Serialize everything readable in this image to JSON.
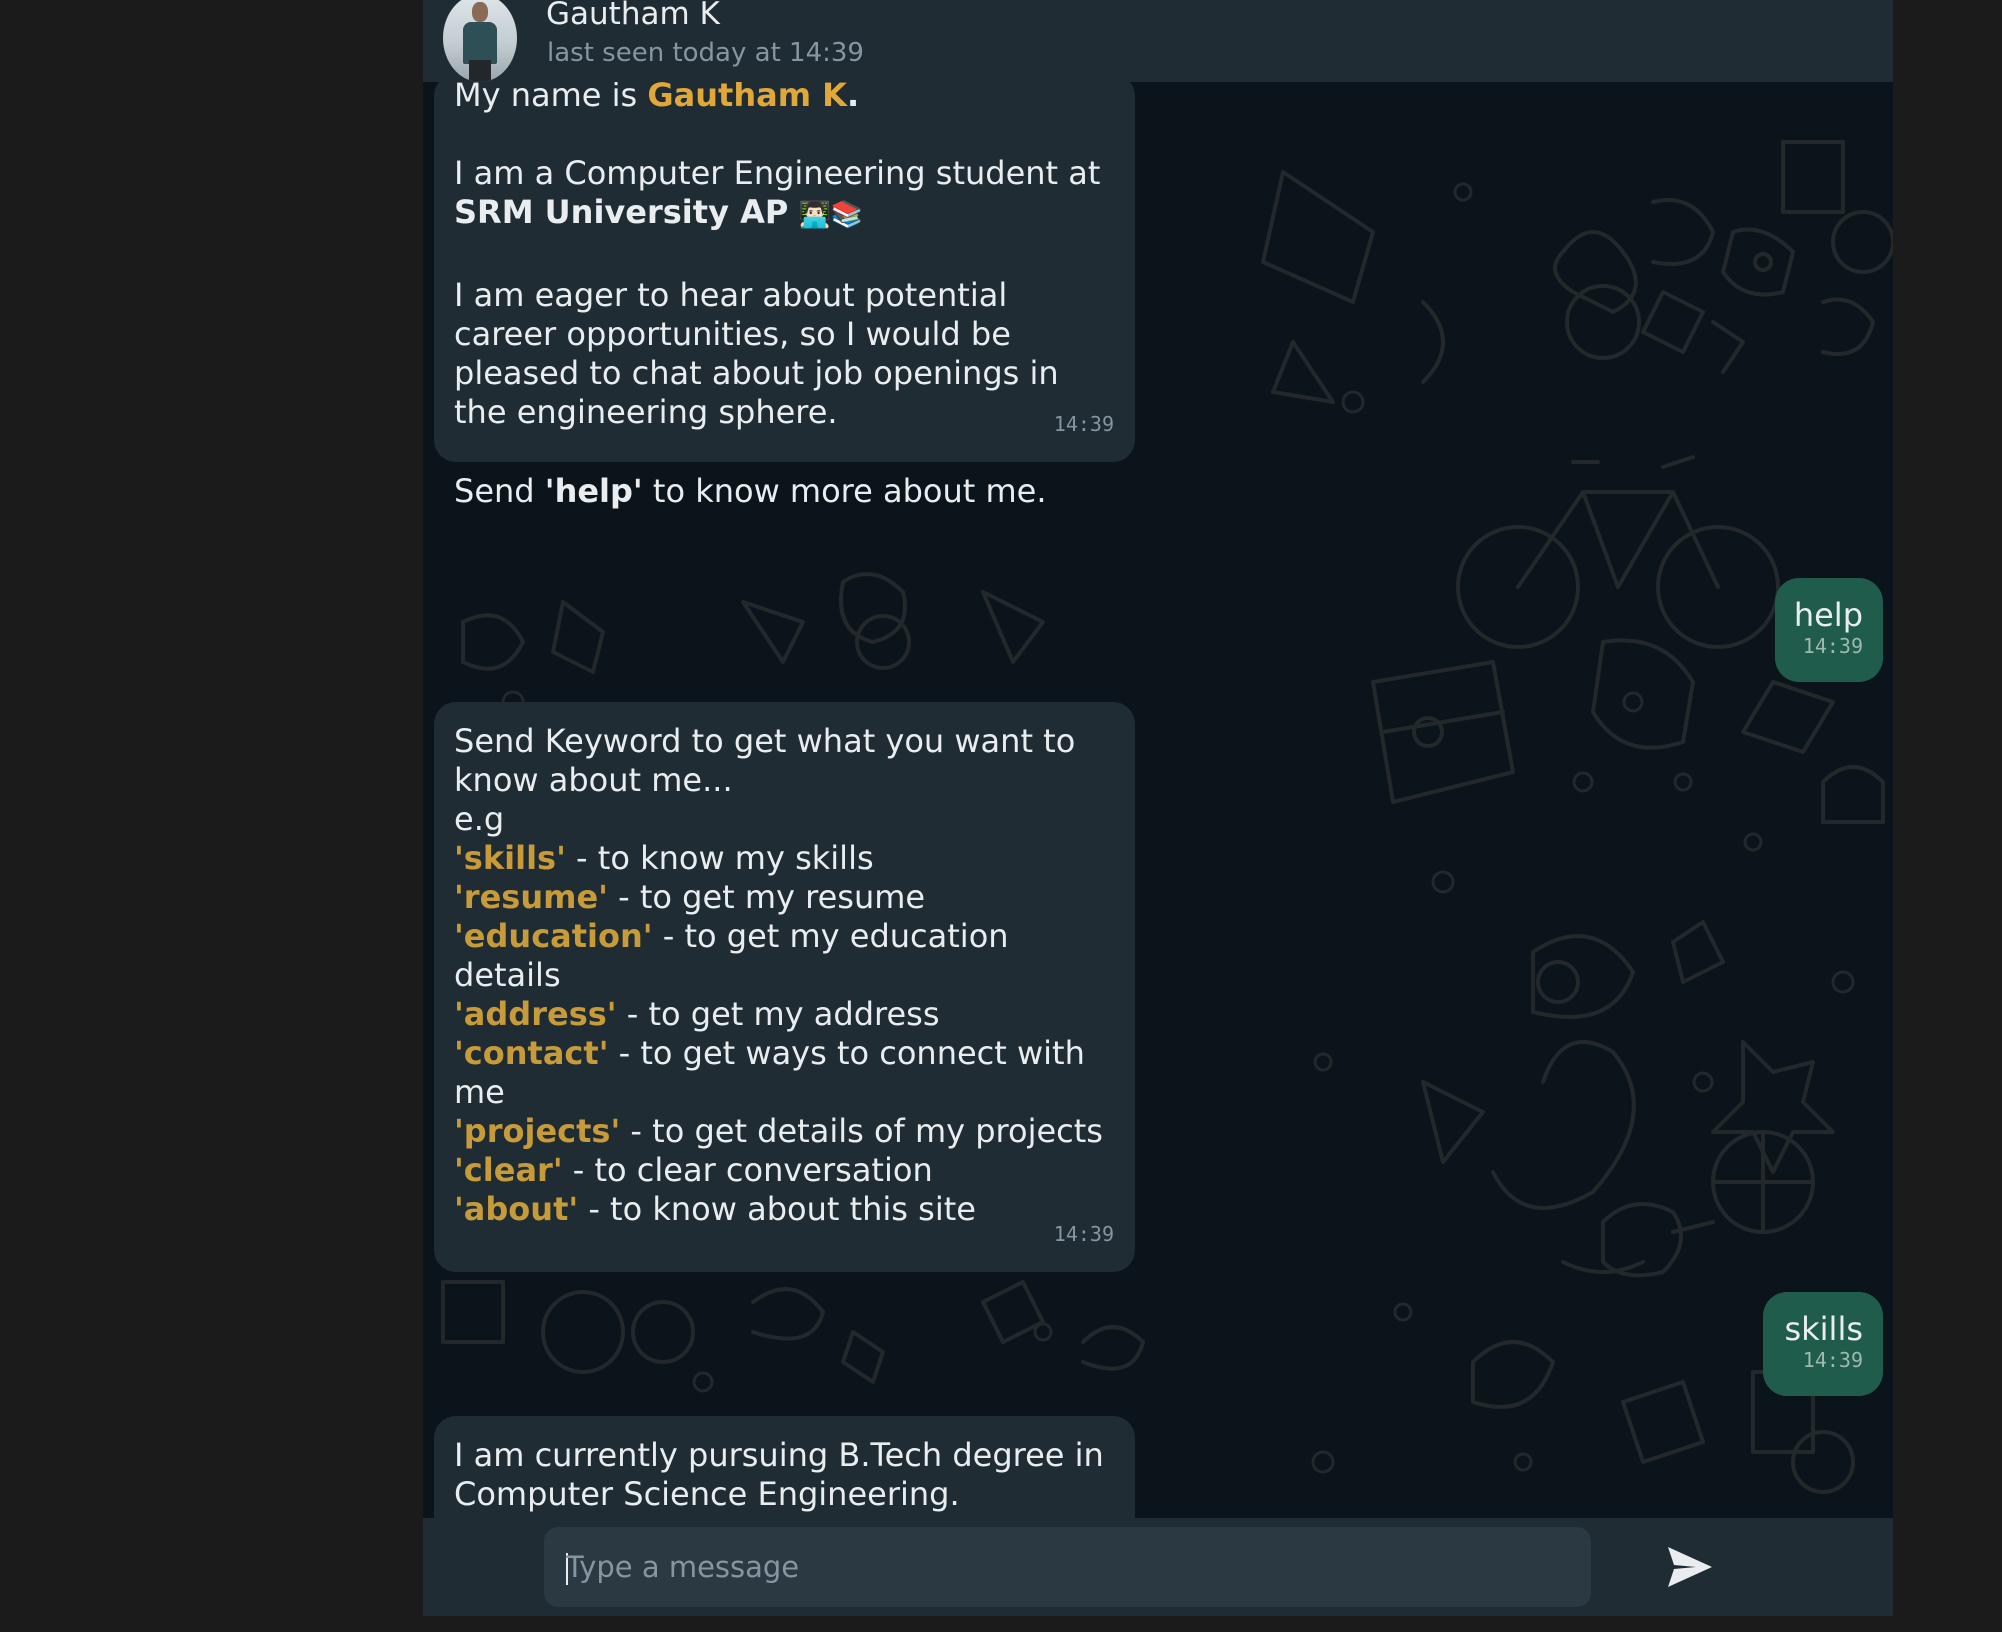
{
  "header": {
    "contact_name": "Gautham K",
    "last_seen": "last seen today at 14:39",
    "avatar": "contact-photo"
  },
  "messages": {
    "intro": {
      "l1_pre": "My name is ",
      "l1_name": "Gautham K",
      "l1_post": ".",
      "l2": "I am a Computer Engineering student at",
      "l3": "SRM University AP",
      "l3_emoji": "👨🏻‍💻📚",
      "l4": "I am eager to hear about potential",
      "l5": "career opportunities, so I would be",
      "l6": "pleased to chat about job openings in",
      "l7": "the engineering sphere.",
      "l8_pre": "Send ",
      "l8_kw": "'help'",
      "l8_post": " to know more about me.",
      "time": "14:39"
    },
    "out_help": {
      "text": "help",
      "time": "14:39"
    },
    "keywords": {
      "l1": "Send Keyword to get what you want to",
      "l2": "know about me...",
      "l3": "e.g",
      "items": [
        {
          "kw": "'skills'",
          "desc": " - to know my skills"
        },
        {
          "kw": "'resume'",
          "desc": " - to get my resume"
        },
        {
          "kw": "'education'",
          "desc": " - to get my education"
        },
        {
          "kw": "",
          "desc": "details"
        },
        {
          "kw": "'address'",
          "desc": " - to get my address"
        },
        {
          "kw": "'contact'",
          "desc": " - to get ways to connect with"
        },
        {
          "kw": "",
          "desc": "me"
        },
        {
          "kw": "'projects'",
          "desc": " - to get details of my projects"
        },
        {
          "kw": "'clear'",
          "desc": " - to clear conversation"
        },
        {
          "kw": "'about'",
          "desc": " - to know about this site"
        }
      ],
      "time": "14:39"
    },
    "out_skills": {
      "text": "skills",
      "time": "14:39"
    },
    "education": {
      "l1": "I am currently pursuing B.Tech degree in",
      "l2": "Computer Science Engineering."
    }
  },
  "footer": {
    "placeholder": "Type a message",
    "send_icon": "send-icon"
  },
  "colors": {
    "panel": "#202c33",
    "chat_bg": "#0b141a",
    "outgoing": "#1f5c4b",
    "keyword": "#c79a3a"
  }
}
